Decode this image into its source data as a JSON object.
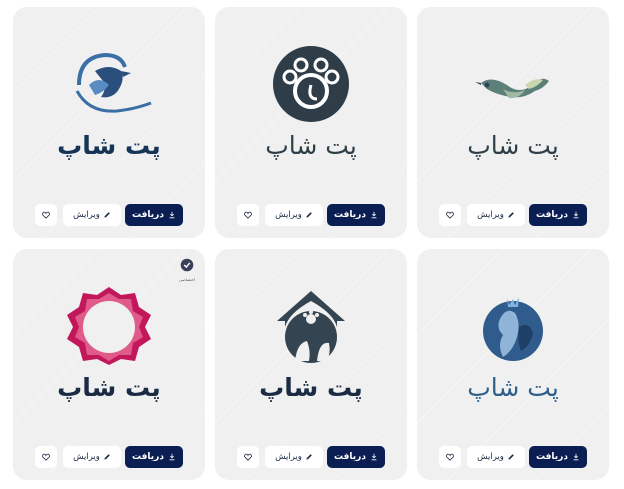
{
  "cards": [
    {
      "brand": "پت شاپ",
      "download_label": "دریافت",
      "edit_label": "ویرایش",
      "logo": "bird-logo-icon"
    },
    {
      "brand": "پت شاپ",
      "download_label": "دریافت",
      "edit_label": "ویرایش",
      "logo": "paw-circle-logo-icon"
    },
    {
      "brand": "پت شاپ",
      "download_label": "دریافت",
      "edit_label": "ویرایش",
      "logo": "eagle-swoosh-logo-icon"
    },
    {
      "brand": "پت شاپ",
      "download_label": "دریافت",
      "edit_label": "ویرایش",
      "logo": "cat-dog-globe-logo-icon"
    },
    {
      "brand": "پت شاپ",
      "download_label": "دریافت",
      "edit_label": "ویرایش",
      "logo": "house-cat-dog-logo-icon"
    },
    {
      "brand": "پت شاپ",
      "download_label": "دریافت",
      "edit_label": "ویرایش",
      "logo": "pink-octagon-frame-logo-icon",
      "badge": "اختصاصی"
    }
  ],
  "colors": {
    "card_bg": "#f0f0f1",
    "primary": "#0b1e53",
    "text": "#1b2b44"
  }
}
